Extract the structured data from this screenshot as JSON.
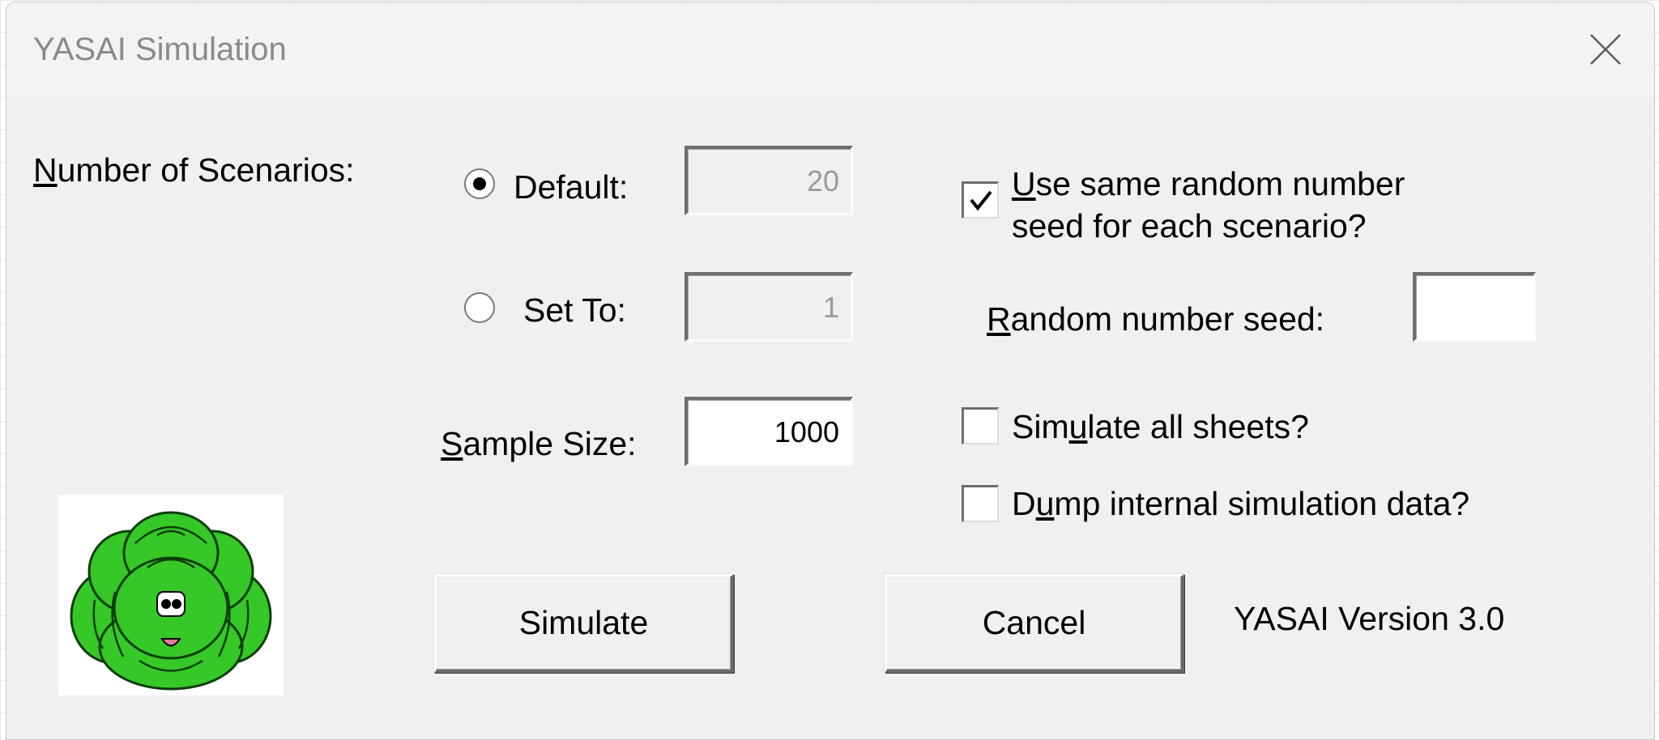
{
  "window": {
    "title": "YASAI Simulation",
    "close_icon": "close-icon"
  },
  "scenarios": {
    "label": "Number of Scenarios:",
    "default_label": "Default:",
    "default_value": "20",
    "default_selected": true,
    "set_to_label": "Set To:",
    "set_to_value": "1",
    "set_to_selected": false
  },
  "sample_size": {
    "label": "Sample Size:",
    "value": "1000"
  },
  "options": {
    "same_seed_line1": "Use same random number",
    "same_seed_line2": "seed for each scenario?",
    "same_seed_checked": true,
    "seed_label": "Random number seed:",
    "seed_value": "",
    "simulate_all_label": "Simulate all sheets?",
    "simulate_all_checked": false,
    "dump_label": "Dump internal simulation data?",
    "dump_checked": false
  },
  "buttons": {
    "simulate": "Simulate",
    "cancel": "Cancel"
  },
  "version_text": "YASAI Version 3.0",
  "logo_icon": "lettuce-logo-icon",
  "colors": {
    "dialog_bg": "#f0f0f0",
    "lettuce_green": "#34c924",
    "lettuce_outline": "#0a3a06"
  }
}
